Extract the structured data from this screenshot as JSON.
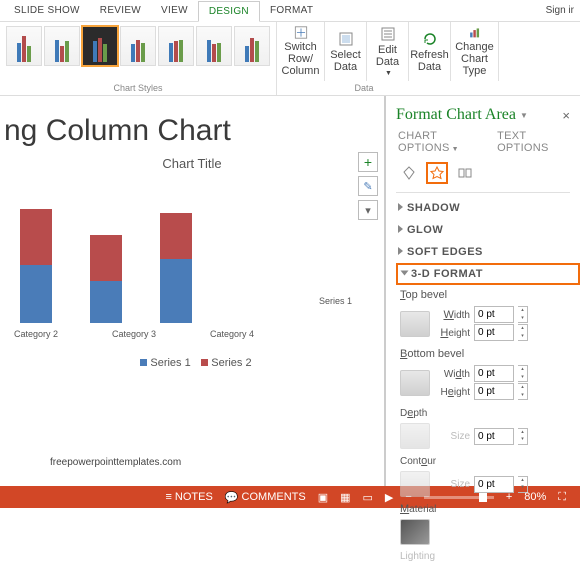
{
  "ribbon_tabs": [
    "SLIDE SHOW",
    "REVIEW",
    "VIEW",
    "DESIGN",
    "FORMAT"
  ],
  "active_tab": 3,
  "signin": "Sign ir",
  "ribbon": {
    "chart_styles_label": "Chart Styles",
    "switch": "Switch Row/ Column",
    "select": "Select Data",
    "edit": "Edit Data",
    "refresh": "Refresh Data",
    "change": "Change Chart Type",
    "data_label": "Data"
  },
  "slide_title": "ng Column Chart",
  "chart_title": "Chart Title",
  "categories": [
    "Category 2",
    "Category 3",
    "Category 4"
  ],
  "series1_label": "Series 1",
  "legend_s1": "Series 1",
  "legend_s2": "Series 2",
  "footer": "freepowerpointtemplates.com",
  "chart_data": {
    "type": "bar",
    "stacked": true,
    "categories": [
      "Category 2",
      "Category 3",
      "Category 4"
    ],
    "series": [
      {
        "name": "Series 1",
        "values": [
          2.5,
          1.8,
          2.8
        ]
      },
      {
        "name": "Series 2",
        "values": [
          2.4,
          2.0,
          2.0
        ]
      }
    ],
    "title": "Chart Title",
    "xlabel": "",
    "ylabel": "",
    "ylim": [
      0,
      6
    ]
  },
  "panel": {
    "title": "Format Chart Area",
    "chart_options": "CHART OPTIONS",
    "text_options": "TEXT OPTIONS",
    "shadow": "SHADOW",
    "glow": "GLOW",
    "soft": "SOFT EDGES",
    "fmt3d": "3-D FORMAT",
    "top_bevel": "Top bevel",
    "bottom_bevel": "Bottom bevel",
    "depth": "Depth",
    "contour": "Contour",
    "material": "Material",
    "lighting": "Lighting",
    "width": "Width",
    "height": "Height",
    "size": "Size",
    "zero": "0 pt"
  },
  "status": {
    "notes": "NOTES",
    "comments": "COMMENTS",
    "zoom": "80%"
  }
}
